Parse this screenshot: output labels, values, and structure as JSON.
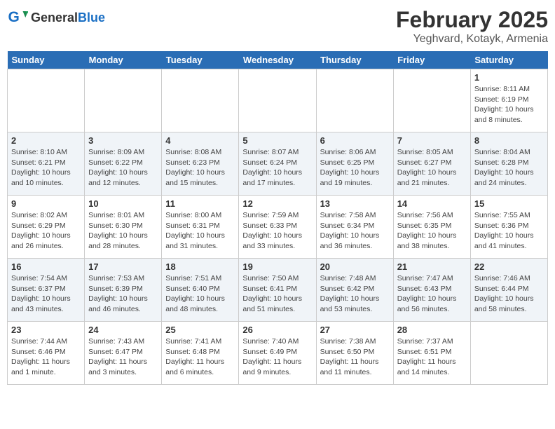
{
  "header": {
    "logo_general": "General",
    "logo_blue": "Blue",
    "month": "February 2025",
    "location": "Yeghvard, Kotayk, Armenia"
  },
  "weekdays": [
    "Sunday",
    "Monday",
    "Tuesday",
    "Wednesday",
    "Thursday",
    "Friday",
    "Saturday"
  ],
  "weeks": [
    [
      {
        "day": "",
        "detail": ""
      },
      {
        "day": "",
        "detail": ""
      },
      {
        "day": "",
        "detail": ""
      },
      {
        "day": "",
        "detail": ""
      },
      {
        "day": "",
        "detail": ""
      },
      {
        "day": "",
        "detail": ""
      },
      {
        "day": "1",
        "detail": "Sunrise: 8:11 AM\nSunset: 6:19 PM\nDaylight: 10 hours and 8 minutes."
      }
    ],
    [
      {
        "day": "2",
        "detail": "Sunrise: 8:10 AM\nSunset: 6:21 PM\nDaylight: 10 hours and 10 minutes."
      },
      {
        "day": "3",
        "detail": "Sunrise: 8:09 AM\nSunset: 6:22 PM\nDaylight: 10 hours and 12 minutes."
      },
      {
        "day": "4",
        "detail": "Sunrise: 8:08 AM\nSunset: 6:23 PM\nDaylight: 10 hours and 15 minutes."
      },
      {
        "day": "5",
        "detail": "Sunrise: 8:07 AM\nSunset: 6:24 PM\nDaylight: 10 hours and 17 minutes."
      },
      {
        "day": "6",
        "detail": "Sunrise: 8:06 AM\nSunset: 6:25 PM\nDaylight: 10 hours and 19 minutes."
      },
      {
        "day": "7",
        "detail": "Sunrise: 8:05 AM\nSunset: 6:27 PM\nDaylight: 10 hours and 21 minutes."
      },
      {
        "day": "8",
        "detail": "Sunrise: 8:04 AM\nSunset: 6:28 PM\nDaylight: 10 hours and 24 minutes."
      }
    ],
    [
      {
        "day": "9",
        "detail": "Sunrise: 8:02 AM\nSunset: 6:29 PM\nDaylight: 10 hours and 26 minutes."
      },
      {
        "day": "10",
        "detail": "Sunrise: 8:01 AM\nSunset: 6:30 PM\nDaylight: 10 hours and 28 minutes."
      },
      {
        "day": "11",
        "detail": "Sunrise: 8:00 AM\nSunset: 6:31 PM\nDaylight: 10 hours and 31 minutes."
      },
      {
        "day": "12",
        "detail": "Sunrise: 7:59 AM\nSunset: 6:33 PM\nDaylight: 10 hours and 33 minutes."
      },
      {
        "day": "13",
        "detail": "Sunrise: 7:58 AM\nSunset: 6:34 PM\nDaylight: 10 hours and 36 minutes."
      },
      {
        "day": "14",
        "detail": "Sunrise: 7:56 AM\nSunset: 6:35 PM\nDaylight: 10 hours and 38 minutes."
      },
      {
        "day": "15",
        "detail": "Sunrise: 7:55 AM\nSunset: 6:36 PM\nDaylight: 10 hours and 41 minutes."
      }
    ],
    [
      {
        "day": "16",
        "detail": "Sunrise: 7:54 AM\nSunset: 6:37 PM\nDaylight: 10 hours and 43 minutes."
      },
      {
        "day": "17",
        "detail": "Sunrise: 7:53 AM\nSunset: 6:39 PM\nDaylight: 10 hours and 46 minutes."
      },
      {
        "day": "18",
        "detail": "Sunrise: 7:51 AM\nSunset: 6:40 PM\nDaylight: 10 hours and 48 minutes."
      },
      {
        "day": "19",
        "detail": "Sunrise: 7:50 AM\nSunset: 6:41 PM\nDaylight: 10 hours and 51 minutes."
      },
      {
        "day": "20",
        "detail": "Sunrise: 7:48 AM\nSunset: 6:42 PM\nDaylight: 10 hours and 53 minutes."
      },
      {
        "day": "21",
        "detail": "Sunrise: 7:47 AM\nSunset: 6:43 PM\nDaylight: 10 hours and 56 minutes."
      },
      {
        "day": "22",
        "detail": "Sunrise: 7:46 AM\nSunset: 6:44 PM\nDaylight: 10 hours and 58 minutes."
      }
    ],
    [
      {
        "day": "23",
        "detail": "Sunrise: 7:44 AM\nSunset: 6:46 PM\nDaylight: 11 hours and 1 minute."
      },
      {
        "day": "24",
        "detail": "Sunrise: 7:43 AM\nSunset: 6:47 PM\nDaylight: 11 hours and 3 minutes."
      },
      {
        "day": "25",
        "detail": "Sunrise: 7:41 AM\nSunset: 6:48 PM\nDaylight: 11 hours and 6 minutes."
      },
      {
        "day": "26",
        "detail": "Sunrise: 7:40 AM\nSunset: 6:49 PM\nDaylight: 11 hours and 9 minutes."
      },
      {
        "day": "27",
        "detail": "Sunrise: 7:38 AM\nSunset: 6:50 PM\nDaylight: 11 hours and 11 minutes."
      },
      {
        "day": "28",
        "detail": "Sunrise: 7:37 AM\nSunset: 6:51 PM\nDaylight: 11 hours and 14 minutes."
      },
      {
        "day": "",
        "detail": ""
      }
    ]
  ]
}
